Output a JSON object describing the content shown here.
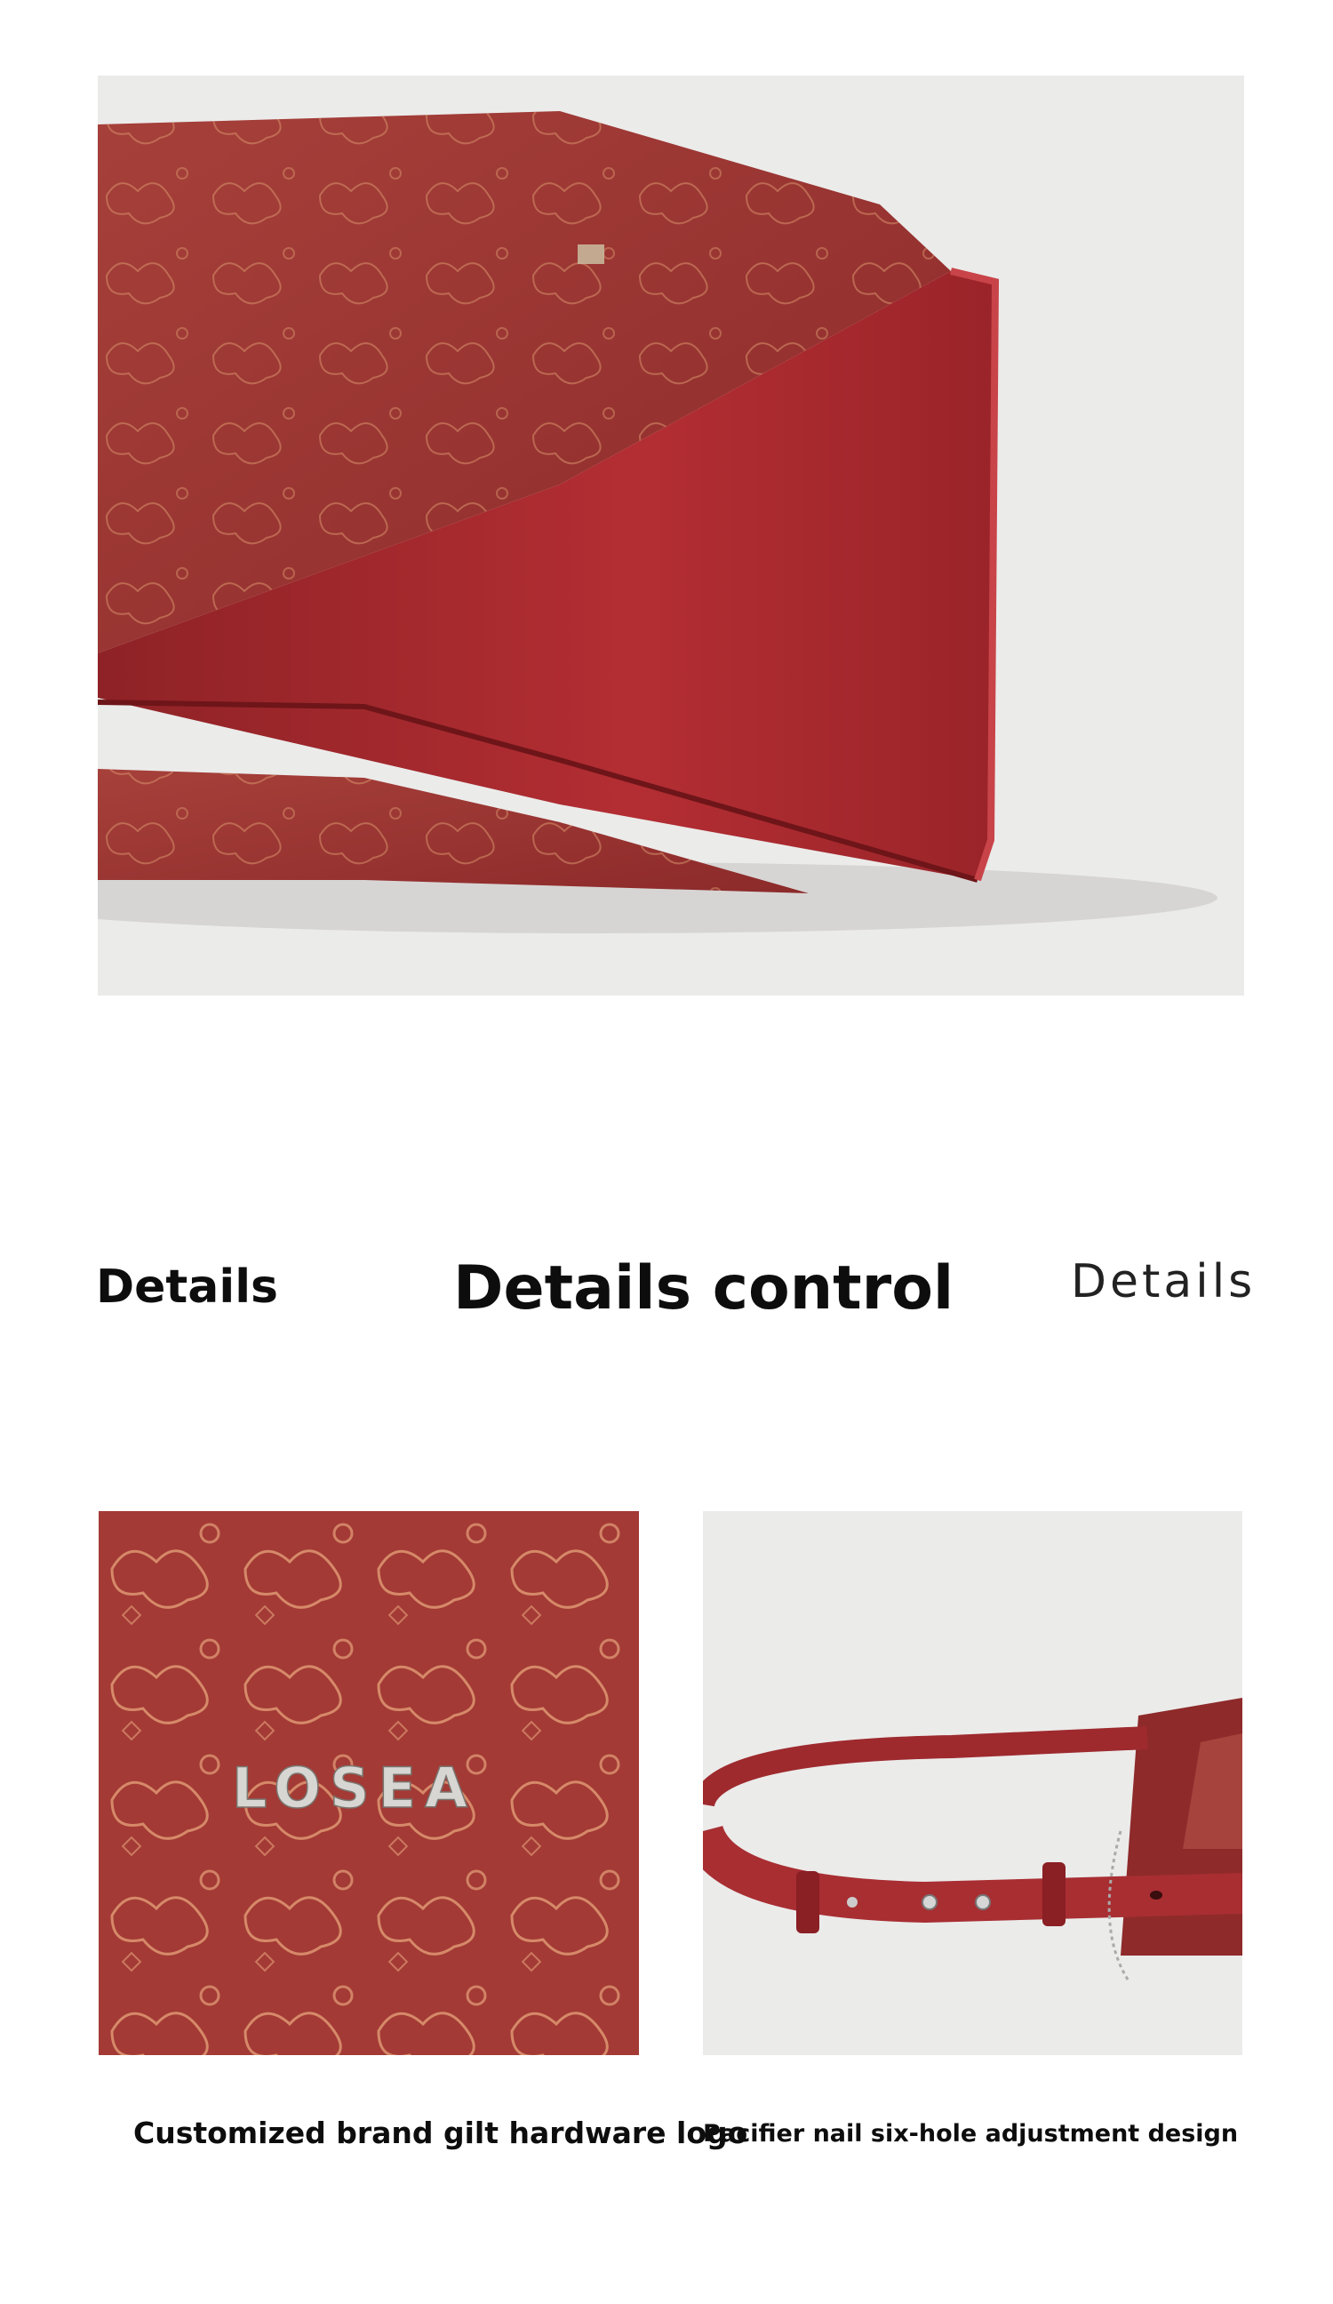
{
  "hero": {
    "description_icon": "bag-corner-photo"
  },
  "headings": {
    "left": "Details",
    "center": "Details control",
    "right": "Details"
  },
  "details": [
    {
      "photo_icon": "logo-hardware-photo",
      "logo_text": "LOSEA",
      "caption": "Customized brand gilt hardware logo"
    },
    {
      "photo_icon": "strap-adjustment-photo",
      "caption": "Pacifier nail six-hole adjustment design"
    }
  ],
  "colors": {
    "leather": "#a33a35",
    "leather_dark": "#7d1f22",
    "background": "#ebebea",
    "text": "#0d0d0d"
  }
}
